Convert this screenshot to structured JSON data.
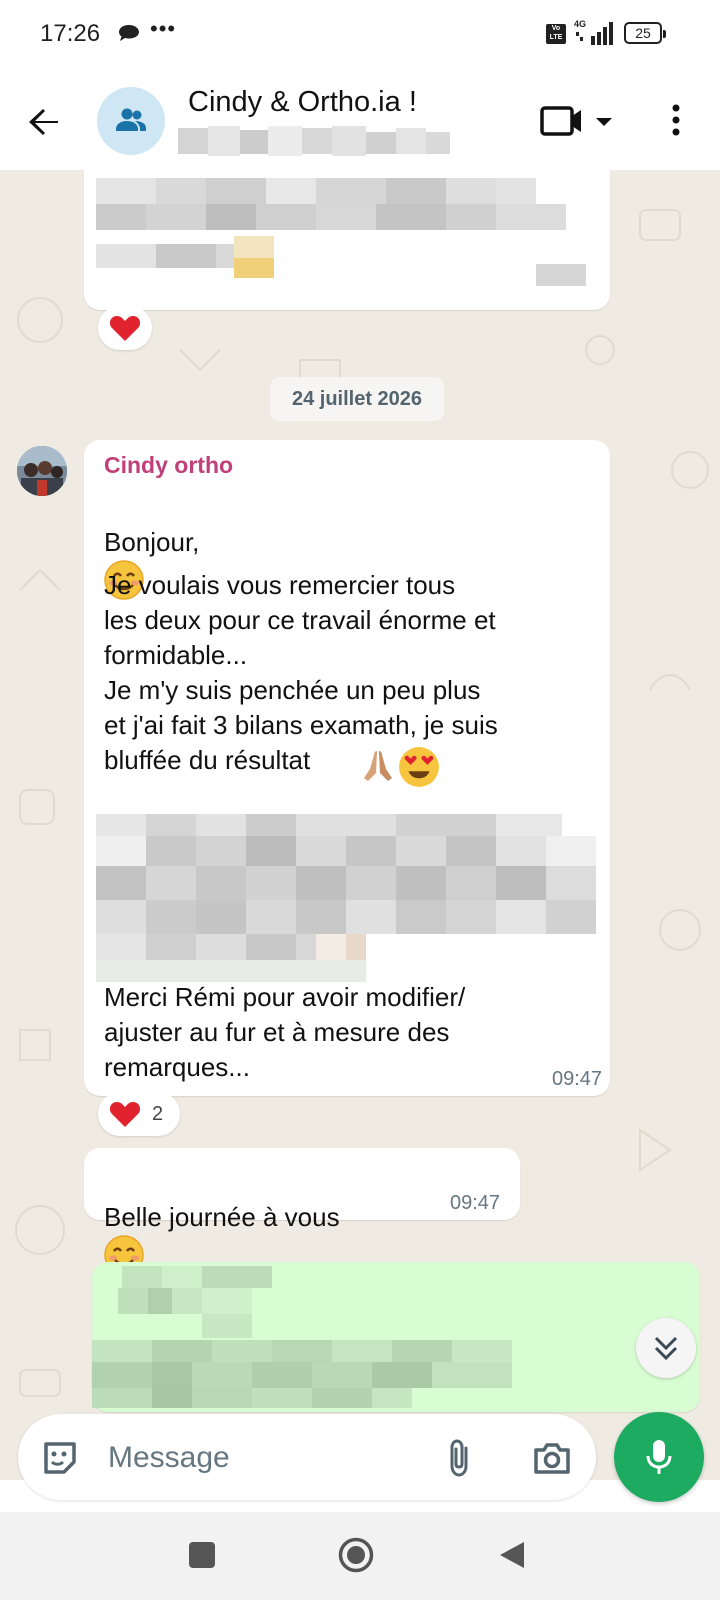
{
  "status": {
    "time": "17:26",
    "battery": "25",
    "network": "4G"
  },
  "header": {
    "title": "Cindy & Ortho.ia !"
  },
  "chat": {
    "date": "24 juillet 2026",
    "sender": "Cindy ortho",
    "msg1_greeting": "Bonjour,",
    "msg1_body": "Je voulais vous remercier  tous\nles deux pour ce travail énorme et\nformidable...\nJe m'y suis penchée un peu plus\net j'ai fait 3 bilans examath, je suis\nbluffée  du résultat",
    "msg1_footer": "Merci Rémi pour avoir modifier/\najuster  au fur et à mesure des\nremarques...",
    "msg1_time": "09:47",
    "msg1_reaction_count": "2",
    "msg2_text": "Belle journée à vous",
    "msg2_time": "09:47"
  },
  "input": {
    "placeholder": "Message"
  },
  "colors": {
    "accent": "#1daa61",
    "sender": "#c2407a",
    "outgoing": "#d9fdd3",
    "chat_bg": "#efeae2"
  },
  "icons": [
    "back-arrow-icon",
    "group-icon",
    "video-call-icon",
    "dropdown-icon",
    "more-vert-icon",
    "heart-icon",
    "smile-emoji-icon",
    "pray-emoji-icon",
    "heart-eyes-emoji-icon",
    "chevron-double-down-icon",
    "sticker-icon",
    "attach-icon",
    "camera-icon",
    "mic-icon",
    "nav-recents-icon",
    "nav-home-icon",
    "nav-back-icon"
  ]
}
